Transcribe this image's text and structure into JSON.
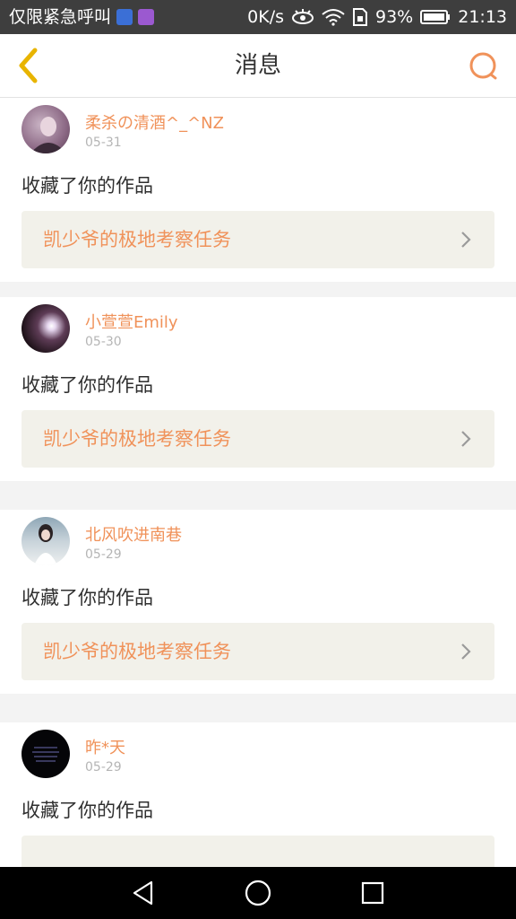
{
  "status_bar": {
    "carrier": "仅限紧急呼叫",
    "speed": "0K/s",
    "battery": "93%",
    "time": "21:13"
  },
  "header": {
    "title": "消息"
  },
  "messages": [
    {
      "username": "柔杀の清酒^_^NZ",
      "date": "05-31",
      "action": "收藏了你的作品",
      "work_title": "凯少爷的极地考察任务"
    },
    {
      "username": "小萱萱Emily",
      "date": "05-30",
      "action": "收藏了你的作品",
      "work_title": "凯少爷的极地考察任务"
    },
    {
      "username": "北风吹进南巷",
      "date": "05-29",
      "action": "收藏了你的作品",
      "work_title": "凯少爷的极地考察任务"
    },
    {
      "username": "昨*天",
      "date": "05-29",
      "action": "收藏了你的作品",
      "work_title": ""
    }
  ],
  "colors": {
    "accent": "#f0925a",
    "back_icon": "#e8b400",
    "status_bar_bg": "#3e3e3e"
  }
}
